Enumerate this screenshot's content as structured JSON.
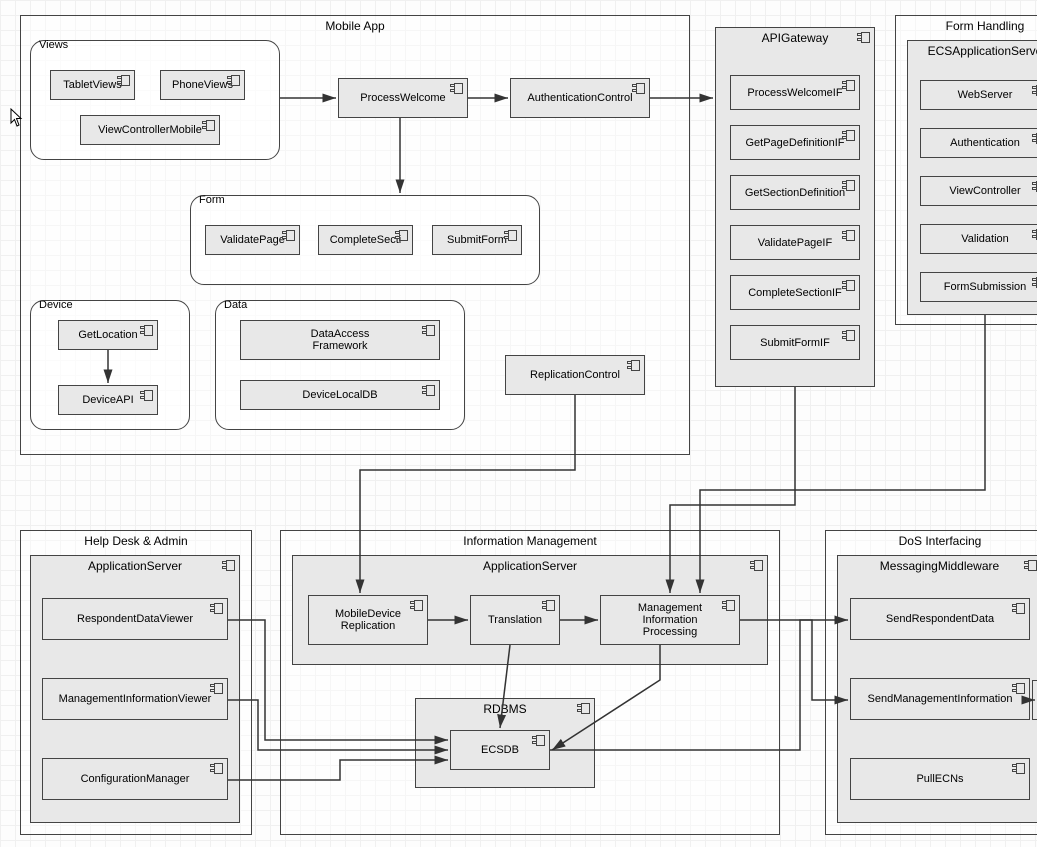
{
  "sections": {
    "mobileApp": "Mobile App",
    "formHandling": "Form Handling",
    "helpDesk": "Help Desk & Admin",
    "infoMgmt": "Information Management",
    "dosInterfacing": "DoS Interfacing"
  },
  "groups": {
    "views": "Views",
    "form": "Form",
    "device": "Device",
    "data": "Data"
  },
  "nodes": {
    "apiGateway": "APIGateway",
    "ecsAppServer": "ECSApplicationServer",
    "hdAppServer": "ApplicationServer",
    "imAppServer": "ApplicationServer",
    "rdbms": "RDBMS",
    "msgMiddleware": "MessagingMiddleware"
  },
  "components": {
    "tabletViews": "TabletViews",
    "phoneViews": "PhoneViews",
    "viewControllerMobile": "ViewControllerMobile",
    "processWelcome": "ProcessWelcome",
    "authControl": "AuthenticationControl",
    "validatePage": "ValidatePage",
    "completeSection": "CompleteSecti",
    "submitForm": "SubmitForm",
    "getLocation": "GetLocation",
    "deviceApi": "DeviceAPI",
    "dataAccessFramework": "DataAccess\nFramework",
    "deviceLocalDb": "DeviceLocalDB",
    "replicationControl": "ReplicationControl",
    "processWelcomeIF": "ProcessWelcomeIF",
    "getPageDefinitionIF": "GetPageDefinitionIF",
    "getSectionDefinitionIF": "GetSectionDefinition",
    "validatePageIF": "ValidatePageIF",
    "completeSectionIF": "CompleteSectionIF",
    "submitFormIF": "SubmitFormIF",
    "webServer": "WebServer",
    "authentication": "Authentication",
    "viewController": "ViewController",
    "validation": "Validation",
    "formSubmission": "FormSubmission",
    "respondentDataViewer": "RespondentDataViewer",
    "mgmtInfoViewer": "ManagementInformationViewer",
    "configManager": "ConfigurationManager",
    "mobileDeviceReplication": "MobileDevice\nReplication",
    "translation": "Translation",
    "mgmtInfoProcessing": "Management\nInformation\nProcessing",
    "ecsdb": "ECSDB",
    "sendRespondentData": "SendRespondentData",
    "sendMgmtInfo": "SendManagementInformation",
    "pullEcns": "PullECNs"
  }
}
